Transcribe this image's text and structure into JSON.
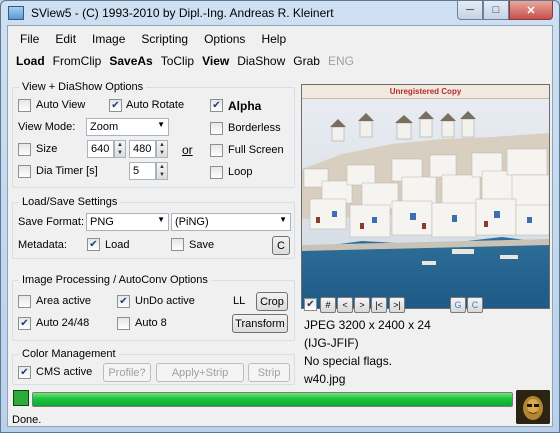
{
  "window": {
    "title": "SView5 - (C) 1993-2010 by Dipl.-Ing. Andreas R. Kleinert",
    "min": "─",
    "max": "□",
    "close": "✕"
  },
  "menu": [
    "File",
    "Edit",
    "Image",
    "Scripting",
    "Options",
    "Help"
  ],
  "toolbar": {
    "load": "Load",
    "fromclip": "FromClip",
    "saveas": "SaveAs",
    "toclip": "ToClip",
    "view": "View",
    "diashow": "DiaShow",
    "grab": "Grab",
    "eng": "ENG"
  },
  "view_group": {
    "title": "View + DiaShow Options",
    "auto_view": {
      "label": "Auto View",
      "checked": false
    },
    "auto_rotate": {
      "label": "Auto Rotate",
      "checked": true
    },
    "alpha": {
      "label": "Alpha",
      "checked": true
    },
    "view_mode_label": "View Mode:",
    "view_mode_value": "Zoom",
    "borderless": {
      "label": "Borderless",
      "checked": false
    },
    "size": {
      "label": "Size",
      "checked": false
    },
    "width": "640",
    "height": "480",
    "or_link": "or",
    "full_screen": {
      "label": "Full Screen",
      "checked": false
    },
    "dia_timer": {
      "label": "Dia Timer [s]",
      "checked": false
    },
    "timer_value": "5",
    "loop": {
      "label": "Loop",
      "checked": false
    }
  },
  "load_group": {
    "title": "Load/Save Settings",
    "save_format_label": "Save Format:",
    "format_value": "PNG",
    "format_ext": "(PiNG)",
    "metadata_label": "Metadata:",
    "load": {
      "label": "Load",
      "checked": true
    },
    "save": {
      "label": "Save",
      "checked": false
    },
    "c_button": "C"
  },
  "proc_group": {
    "title": "Image Processing / AutoConv Options",
    "area_active": {
      "label": "Area active",
      "checked": false
    },
    "undo_active": {
      "label": "UnDo active",
      "checked": true
    },
    "ll": "LL",
    "crop": "Crop",
    "auto2448": {
      "label": "Auto 24/48",
      "checked": true
    },
    "auto8": {
      "label": "Auto 8",
      "checked": false
    },
    "transform": "Transform"
  },
  "color_group": {
    "title": "Color Management",
    "cms_active": {
      "label": "CMS active",
      "checked": true
    },
    "profile": "Profile?",
    "apply_strip": "Apply+Strip",
    "strip": "Strip"
  },
  "preview": {
    "banner": "Unregistered Copy"
  },
  "nav": {
    "check": true,
    "hash": "#",
    "prev": "<",
    "next": ">",
    "first": "|<",
    "last": ">|",
    "g": "G",
    "c": "C"
  },
  "image_info": {
    "line1": "JPEG 3200 x 2400 x 24",
    "line2": "(IJG-JFIF)",
    "line3": "No special flags.",
    "file": "w40.jpg"
  },
  "progress": {
    "fraction": 1.0
  },
  "status": "Done.",
  "colors": {
    "progress": "#17c53d",
    "banner_text": "#b52a2a",
    "sea": "#2a7fb8"
  }
}
